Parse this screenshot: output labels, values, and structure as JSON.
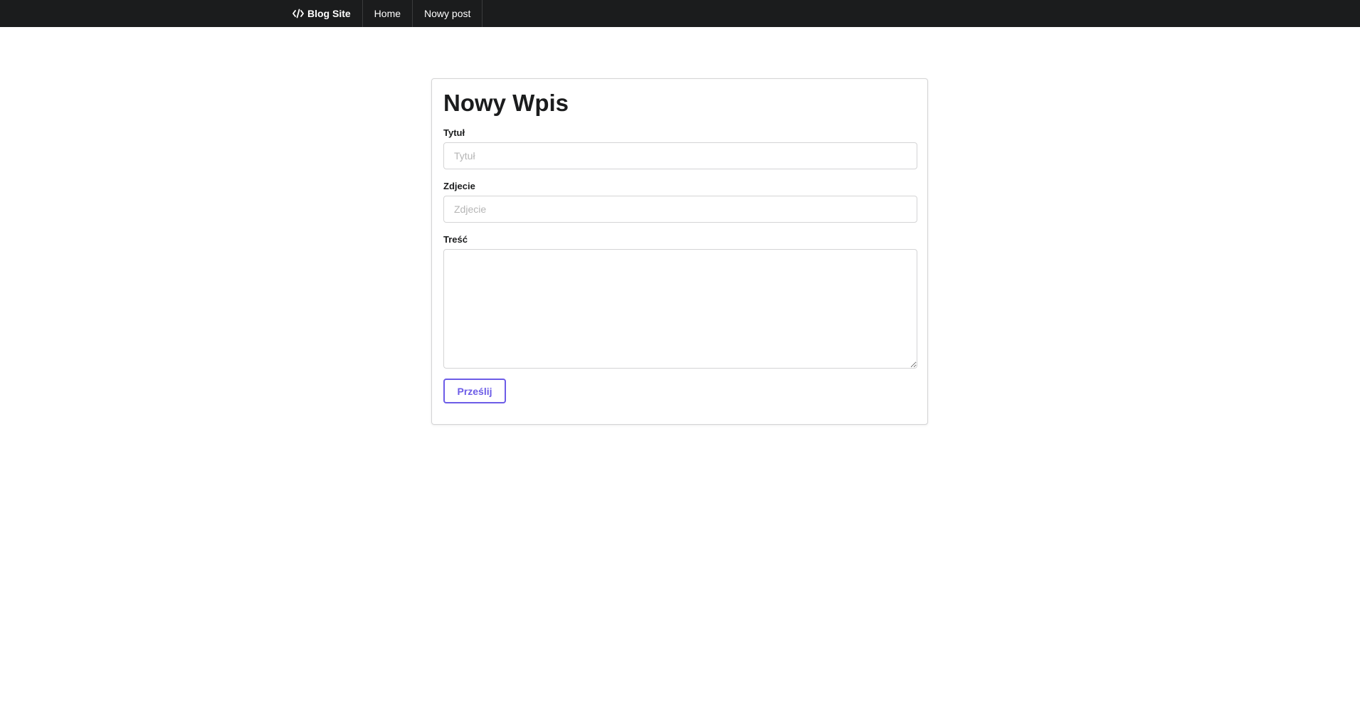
{
  "nav": {
    "brand_label": "Blog Site",
    "brand_icon": "code-icon",
    "items": [
      {
        "label": "Home"
      },
      {
        "label": "Nowy post"
      }
    ]
  },
  "form": {
    "title": "Nowy Wpis",
    "fields": [
      {
        "label": "Tytuł",
        "placeholder": "Tytuł",
        "value": ""
      },
      {
        "label": "Zdjecie",
        "placeholder": "Zdjecie",
        "value": ""
      }
    ],
    "content": {
      "label": "Treść",
      "value": ""
    },
    "submit_label": "Prześlij"
  },
  "colors": {
    "topbar": "#1b1c1d",
    "accent": "#6c5ce7",
    "border": "#d4d4d5"
  }
}
